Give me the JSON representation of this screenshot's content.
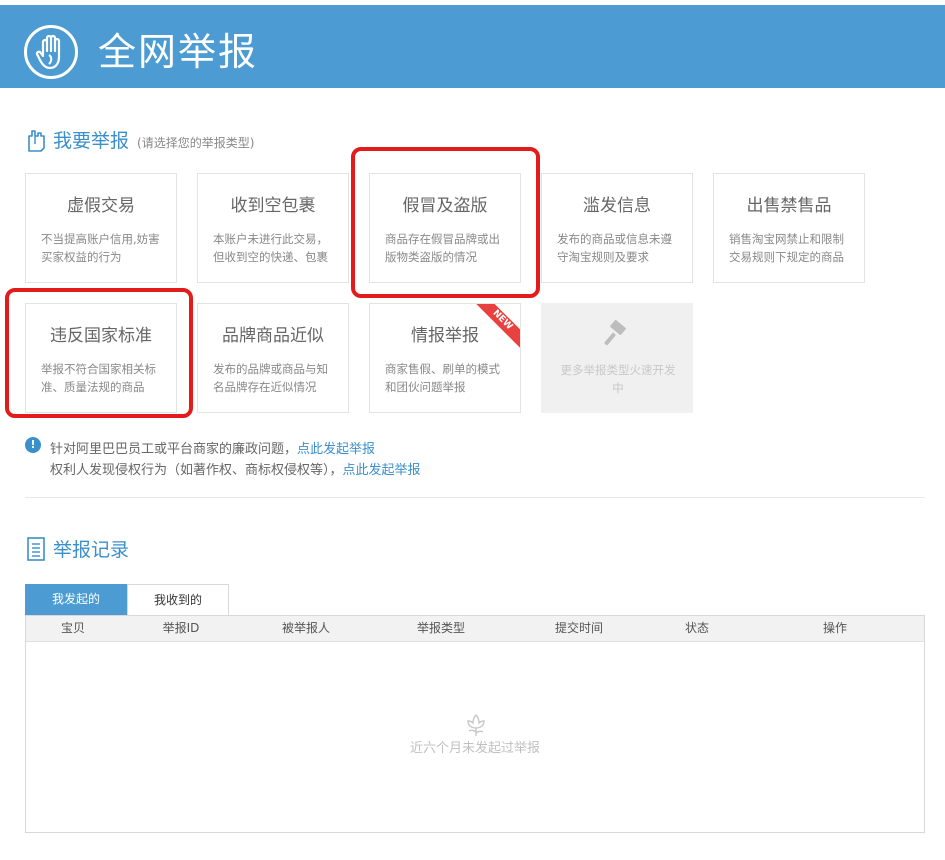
{
  "header": {
    "title": "全网举报",
    "icon": "hand-logo-icon"
  },
  "report_section": {
    "title": "我要举报",
    "hint": "(请选择您的举报类型)",
    "icon": "hand-pointer-icon"
  },
  "cards": [
    {
      "title": "虚假交易",
      "desc": "不当提高账户信用,妨害买家权益的行为"
    },
    {
      "title": "收到空包裹",
      "desc": "本账户未进行此交易，但收到空的快递、包裹"
    },
    {
      "title": "假冒及盗版",
      "desc": "商品存在假冒品牌或出版物类盗版的情况"
    },
    {
      "title": "滥发信息",
      "desc": "发布的商品或信息未遵守淘宝规则及要求"
    },
    {
      "title": "出售禁售品",
      "desc": "销售淘宝网禁止和限制交易规则下规定的商品"
    },
    {
      "title": "违反国家标准",
      "desc": "举报不符合国家相关标准、质量法规的商品"
    },
    {
      "title": "品牌商品近似",
      "desc": "发布的品牌或商品与知名品牌存在近似情况"
    },
    {
      "title": "情报举报",
      "desc": "商家售假、刷单的模式和团伙问题举报",
      "badge": "NEW"
    },
    {
      "desc": "更多举报类型火速开发中",
      "icon": "gavel-icon"
    }
  ],
  "notice": {
    "icon": "info-icon",
    "line1_text": "针对阿里巴巴员工或平台商家的廉政问题，",
    "line1_link": "点此发起举报",
    "line2_text": "权利人发现侵权行为（如著作权、商标权侵权等），",
    "line2_link": "点此发起举报"
  },
  "records_section": {
    "title": "举报记录",
    "icon": "document-icon"
  },
  "tabs": [
    {
      "label": "我发起的",
      "active": true
    },
    {
      "label": "我收到的",
      "active": false
    }
  ],
  "table": {
    "columns": [
      "宝贝",
      "举报ID",
      "被举报人",
      "举报类型",
      "提交时间",
      "状态",
      "操作"
    ],
    "empty_text": "近六个月未发起过举报",
    "empty_icon": "flower-icon"
  },
  "colors": {
    "brand_blue": "#4c9cd3",
    "link_blue": "#3b8fcb",
    "highlight_red": "#e31b1b",
    "badge_red": "#e8413f"
  }
}
